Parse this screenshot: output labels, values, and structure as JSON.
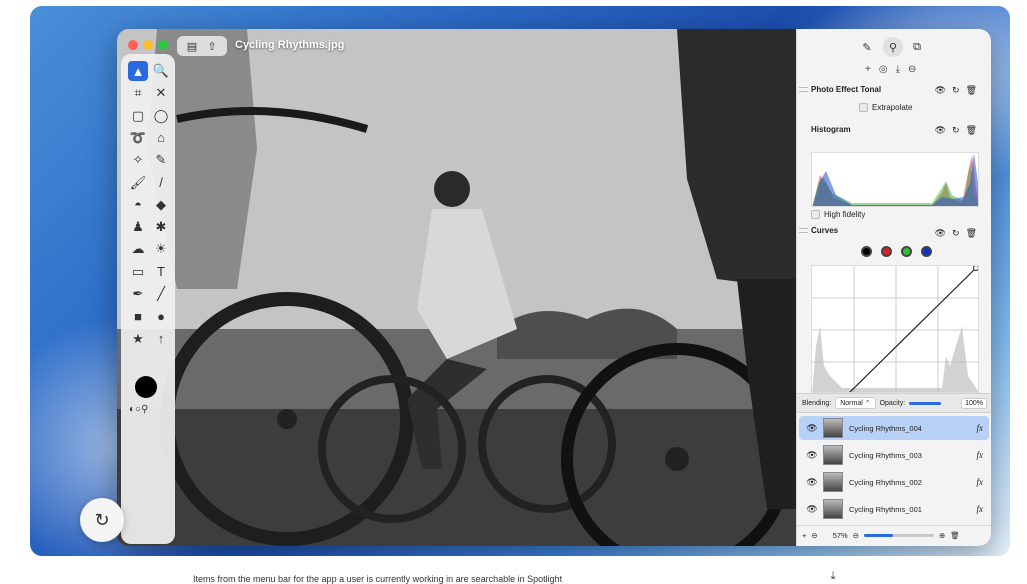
{
  "window": {
    "title": "Cycling Rhythms.jpg"
  },
  "title_buttons": [
    "sidebar-icon",
    "share-icon"
  ],
  "toolbar": {
    "tools": [
      {
        "name": "move-tool-icon",
        "glyph": "▲",
        "active": true
      },
      {
        "name": "zoom-tool-icon",
        "glyph": "🔍"
      },
      {
        "name": "crop-tool-icon",
        "glyph": "⌗"
      },
      {
        "name": "transform-tool-icon",
        "glyph": "✕"
      },
      {
        "name": "rect-select-icon",
        "glyph": "▢"
      },
      {
        "name": "ellipse-select-icon",
        "glyph": "◯"
      },
      {
        "name": "lasso-icon",
        "glyph": "➰"
      },
      {
        "name": "polygon-lasso-icon",
        "glyph": "⌂"
      },
      {
        "name": "magic-wand-icon",
        "glyph": "✧"
      },
      {
        "name": "quick-select-icon",
        "glyph": "✎"
      },
      {
        "name": "brush-icon",
        "glyph": "🖌"
      },
      {
        "name": "pencil-icon",
        "glyph": "/"
      },
      {
        "name": "fill-icon",
        "glyph": "◓"
      },
      {
        "name": "eraser-icon",
        "glyph": "◆"
      },
      {
        "name": "clone-stamp-icon",
        "glyph": "♟"
      },
      {
        "name": "heal-icon",
        "glyph": "✱"
      },
      {
        "name": "smudge-icon",
        "glyph": "☁"
      },
      {
        "name": "lighten-icon",
        "glyph": "☀"
      },
      {
        "name": "gradient-icon",
        "glyph": "▭"
      },
      {
        "name": "text-tool-icon",
        "glyph": "T"
      },
      {
        "name": "pen-tool-icon",
        "glyph": "✒"
      },
      {
        "name": "line-tool-icon",
        "glyph": "╱"
      },
      {
        "name": "rectangle-shape-icon",
        "glyph": "■"
      },
      {
        "name": "ellipse-shape-icon",
        "glyph": "●"
      },
      {
        "name": "star-shape-icon",
        "glyph": "★"
      },
      {
        "name": "arrow-shape-icon",
        "glyph": "↑"
      }
    ]
  },
  "panel": {
    "adjustments_add": [
      "+",
      "◎",
      "⤓",
      "⊖"
    ],
    "effect": {
      "title": "Photo Effect Tonal",
      "option": "Extrapolate"
    },
    "histogram": {
      "title": "Histogram",
      "option": "High fidelity"
    },
    "curves": {
      "title": "Curves",
      "channels": [
        "#000000",
        "#e02020",
        "#30c030",
        "#1030d0"
      ]
    },
    "blending": {
      "label": "Blending:",
      "mode": "Normal",
      "opacity_label": "Opacity:",
      "opacity": "100%",
      "opacity_fraction": 1.0
    },
    "layers": [
      {
        "name": "Cycling Rhythms_004",
        "selected": true
      },
      {
        "name": "Cycling Rhythms_003",
        "selected": false
      },
      {
        "name": "Cycling Rhythms_002",
        "selected": false
      },
      {
        "name": "Cycling Rhythms_001",
        "selected": false
      }
    ],
    "footer": {
      "zoom": "57%",
      "zoom_fraction": 0.42
    }
  },
  "caption": "Items from the menu bar for the app a user is currently working in are searchable in Spotlight",
  "colors": {
    "accent": "#2a6ae0",
    "selected_layer": "#b8d2f7"
  }
}
